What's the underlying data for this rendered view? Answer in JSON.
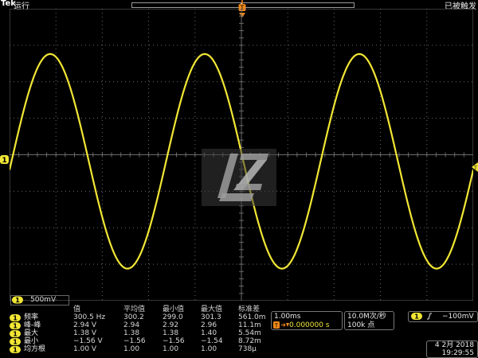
{
  "colors": {
    "background": "#000000",
    "ch1": "#f1e635",
    "grid": "#6a6a6a",
    "text": "#d8d8d8"
  },
  "header": {
    "brand": "Tek",
    "run_state": "运行",
    "trigger_state": "已被触发"
  },
  "markers": {
    "ch1_badge": "1",
    "trigger_point": "T"
  },
  "icons": {
    "ch1_marker": "circle-1-icon",
    "trigger_level": "arrow-left-icon",
    "trigger_position": "t-marker-icon",
    "logo": "lz-logo-icon",
    "trigger_slope": "rising-edge-icon"
  },
  "channel": {
    "badge": "1",
    "scale": "500mV"
  },
  "waveform": {
    "shape": "sine",
    "frequency_hz": 300.5,
    "visible_cycles": 3
  },
  "measurements": {
    "headers": [
      "值",
      "平均值",
      "最小值",
      "最大值",
      "标准差"
    ],
    "rows": [
      {
        "badge": "1",
        "name": "频率",
        "values": [
          "300.5 Hz",
          "300.2",
          "299.0",
          "301.3",
          "561.0m"
        ]
      },
      {
        "badge": "1",
        "name": "峰-峰",
        "values": [
          "2.94 V",
          "2.94",
          "2.92",
          "2.96",
          "11.1m"
        ]
      },
      {
        "badge": "1",
        "name": "最大",
        "values": [
          "1.38 V",
          "1.38",
          "1.38",
          "1.40",
          "5.54m"
        ]
      },
      {
        "badge": "1",
        "name": "最小",
        "values": [
          "−1.56 V",
          "−1.56",
          "−1.56",
          "−1.54",
          "8.72m"
        ]
      },
      {
        "badge": "1",
        "name": "均方根",
        "values": [
          "1.00 V",
          "1.00",
          "1.00",
          "1.00",
          "738μ"
        ]
      }
    ]
  },
  "timebase": {
    "scale": "1.00ms",
    "delay": "0.000000 s"
  },
  "acquisition": {
    "rate": "10.0M次/秒",
    "record_length": "100k 点"
  },
  "trigger": {
    "badge": "1",
    "level": "−100mV"
  },
  "datetime": {
    "date": "4 2月 2018",
    "time": "19:29:55"
  }
}
